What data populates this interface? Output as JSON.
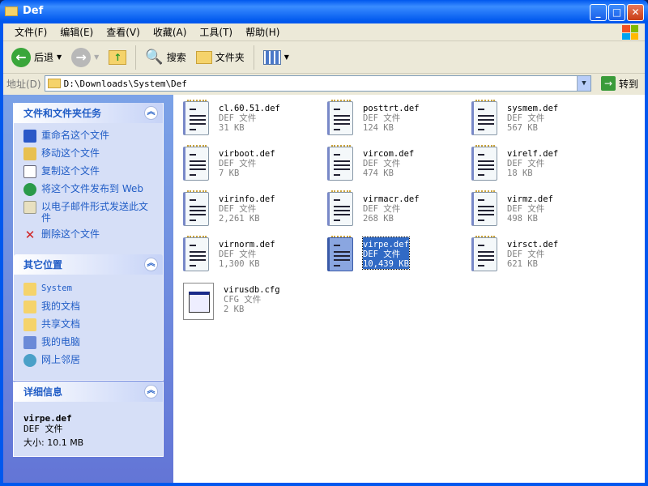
{
  "window": {
    "title": "Def"
  },
  "menu": [
    "文件(F)",
    "编辑(E)",
    "查看(V)",
    "收藏(A)",
    "工具(T)",
    "帮助(H)"
  ],
  "toolbar": {
    "back": "后退",
    "search": "搜索",
    "folders": "文件夹"
  },
  "address": {
    "label": "地址(D)",
    "value": "D:\\Downloads\\System\\Def",
    "go": "转到"
  },
  "tasks": {
    "title": "文件和文件夹任务",
    "items": [
      "重命名这个文件",
      "移动这个文件",
      "复制这个文件",
      "将这个文件发布到 Web",
      "以电子邮件形式发送此文件",
      "删除这个文件"
    ]
  },
  "places": {
    "title": "其它位置",
    "items": [
      "System",
      "我的文档",
      "共享文档",
      "我的电脑",
      "网上邻居"
    ]
  },
  "details": {
    "title": "详细信息",
    "name": "virpe.def",
    "type": "DEF 文件",
    "size": "大小: 10.1 MB"
  },
  "files": [
    {
      "name": "cl.60.51.def",
      "type": "DEF 文件",
      "size": "31 KB"
    },
    {
      "name": "posttrt.def",
      "type": "DEF 文件",
      "size": "124 KB"
    },
    {
      "name": "sysmem.def",
      "type": "DEF 文件",
      "size": "567 KB"
    },
    {
      "name": "virboot.def",
      "type": "DEF 文件",
      "size": "7 KB"
    },
    {
      "name": "vircom.def",
      "type": "DEF 文件",
      "size": "474 KB"
    },
    {
      "name": "virelf.def",
      "type": "DEF 文件",
      "size": "18 KB"
    },
    {
      "name": "virinfo.def",
      "type": "DEF 文件",
      "size": "2,261 KB"
    },
    {
      "name": "virmacr.def",
      "type": "DEF 文件",
      "size": "268 KB"
    },
    {
      "name": "virmz.def",
      "type": "DEF 文件",
      "size": "498 KB"
    },
    {
      "name": "virnorm.def",
      "type": "DEF 文件",
      "size": "1,300 KB"
    },
    {
      "name": "virpe.def",
      "type": "DEF 文件",
      "size": "10,439 KB",
      "selected": true
    },
    {
      "name": "virsct.def",
      "type": "DEF 文件",
      "size": "621 KB"
    },
    {
      "name": "virusdb.cfg",
      "type": "CFG 文件",
      "size": "2 KB",
      "kind": "cfg"
    }
  ]
}
